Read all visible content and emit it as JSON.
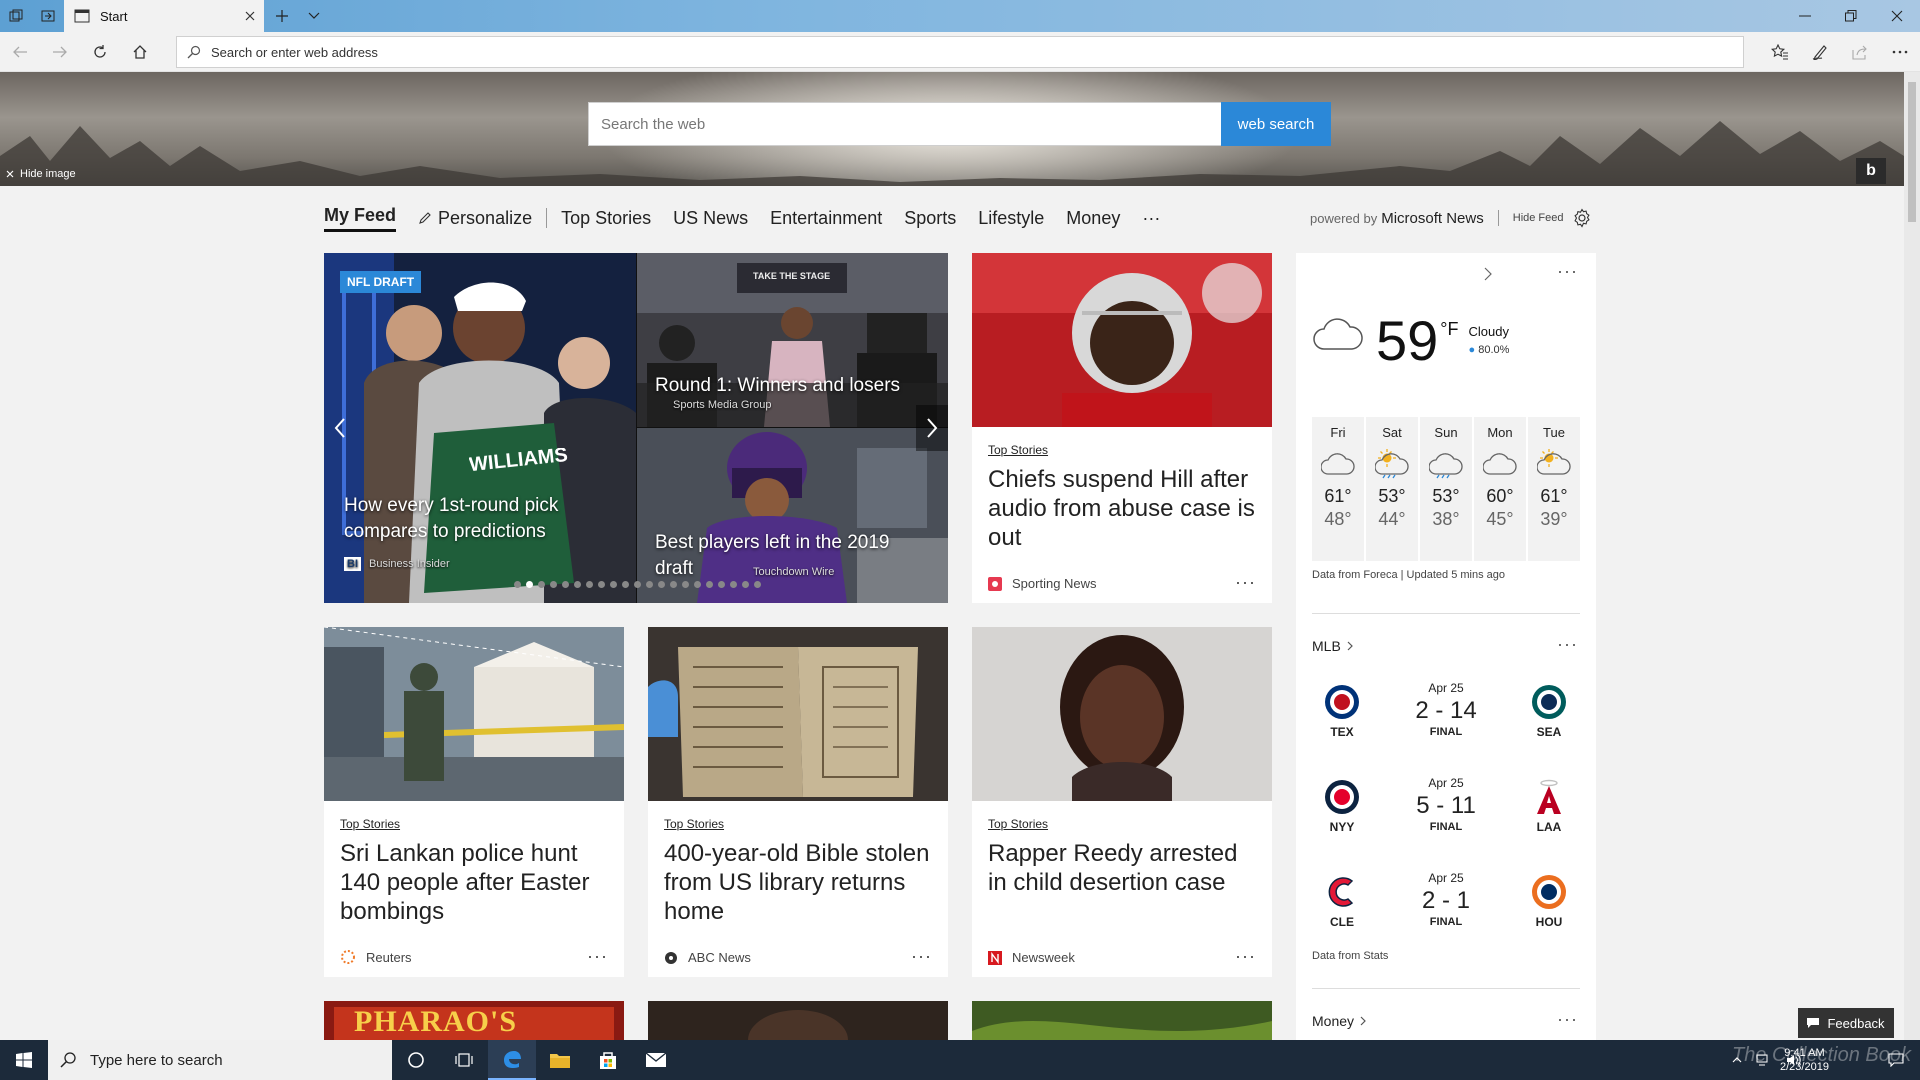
{
  "browser": {
    "tab_title": "Start",
    "address_placeholder": "Search or enter web address"
  },
  "hero": {
    "search_placeholder": "Search the web",
    "search_button": "web search",
    "hide_image": "Hide image",
    "bing_logo": "b"
  },
  "feed_nav": {
    "items": [
      "My Feed",
      "Personalize",
      "Top Stories",
      "US News",
      "Entertainment",
      "Sports",
      "Lifestyle",
      "Money",
      "···"
    ],
    "powered_by": "powered by",
    "brand": "Microsoft News",
    "hide_feed": "Hide Feed"
  },
  "carousel": {
    "badge": "NFL DRAFT",
    "main_title": "How every 1st-round pick compares to predictions",
    "main_source_logo": "BI",
    "main_source": "Business Insider",
    "top_title": "Round 1: Winners and losers",
    "top_source": "Sports Media Group",
    "bottom_title": "Best players left in the 2019 draft",
    "bottom_source": "Touchdown Wire",
    "jersey_text": "WILLIAMS",
    "banner_text": "TAKE THE STAGE",
    "dot_count": 21,
    "active_dot": 1
  },
  "cards": [
    {
      "category": "Top Stories",
      "headline": "Chiefs suspend Hill after audio from abuse case is out",
      "source": "Sporting News"
    },
    {
      "category": "Top Stories",
      "headline": "Sri Lankan police hunt 140 people after Easter bombings",
      "source": "Reuters"
    },
    {
      "category": "Top Stories",
      "headline": "400-year-old Bible stolen from US library returns home",
      "source": "ABC News"
    },
    {
      "category": "Top Stories",
      "headline": "Rapper Reedy arrested in child desertion case",
      "source": "Newsweek"
    }
  ],
  "bottom_card_text": "PHARAO'S",
  "weather": {
    "temp": "59",
    "unit": "°F",
    "condition": "Cloudy",
    "rain": "80.0%",
    "forecast": [
      {
        "day": "Fri",
        "hi": "61°",
        "lo": "48°",
        "icon": "cloud-icon"
      },
      {
        "day": "Sat",
        "hi": "53°",
        "lo": "44°",
        "icon": "sun-rain-icon"
      },
      {
        "day": "Sun",
        "hi": "53°",
        "lo": "38°",
        "icon": "cloud-rain-icon"
      },
      {
        "day": "Mon",
        "hi": "60°",
        "lo": "45°",
        "icon": "cloud-icon"
      },
      {
        "day": "Tue",
        "hi": "61°",
        "lo": "39°",
        "icon": "partly-sunny-icon"
      }
    ],
    "credit": "Data from Foreca | Updated 5 mins ago"
  },
  "mlb": {
    "title": "MLB",
    "games": [
      {
        "date": "Apr 25",
        "score": "2 - 14",
        "status": "FINAL",
        "home": "TEX",
        "away": "SEA"
      },
      {
        "date": "Apr 25",
        "score": "5 - 11",
        "status": "FINAL",
        "home": "NYY",
        "away": "LAA"
      },
      {
        "date": "Apr 25",
        "score": "2 - 1",
        "status": "FINAL",
        "home": "CLE",
        "away": "HOU"
      }
    ],
    "credit": "Data from Stats"
  },
  "money": {
    "title": "Money"
  },
  "feedback": "Feedback",
  "taskbar": {
    "search_placeholder": "Type here to search",
    "time": "9:41 AM",
    "date": "2/23/2019",
    "watermark": "The Collection Book"
  },
  "colors": {
    "accent": "#2b88d8",
    "taskbar": "#1c2a3a"
  }
}
